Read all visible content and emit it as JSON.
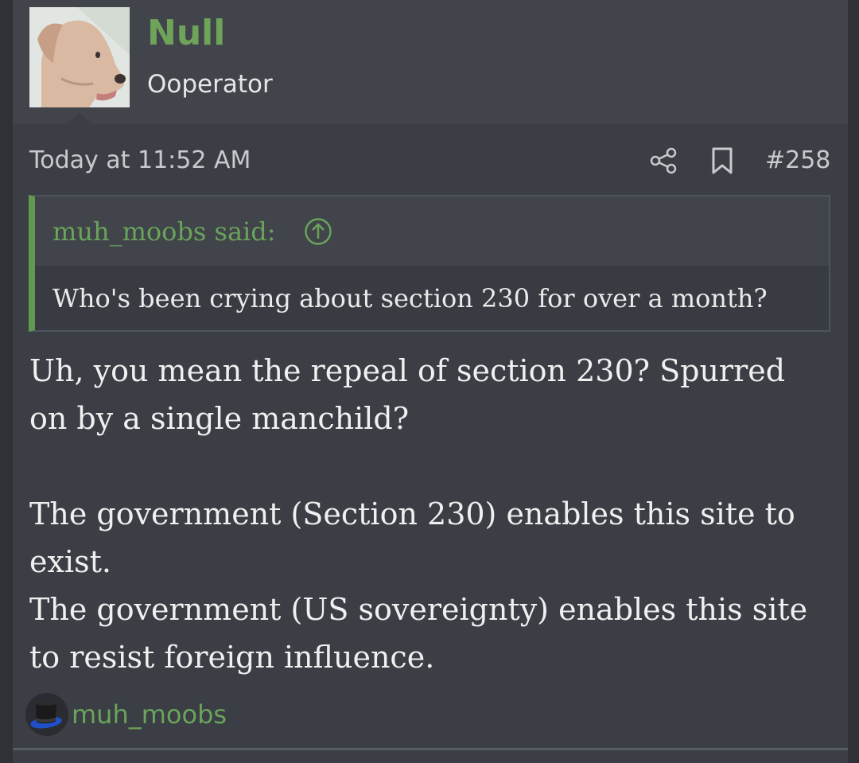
{
  "user": {
    "name": "Null",
    "title": "Ooperator"
  },
  "post": {
    "date": "Today at 11:52 AM",
    "number": "#258"
  },
  "quote": {
    "author": "muh_moobs said:",
    "text": "Who's been crying about section 230 for over a month?"
  },
  "message": {
    "p1": "Uh, you mean the repeal of section 230? Spurred on by a single manchild?",
    "p2": "The government (Section 230) enables this site to exist.",
    "p3": "The government (US sovereignty) enables this site to resist foreign influence."
  },
  "reactions": {
    "icon": "top-hat-icon",
    "user": "muh_moobs"
  },
  "colors": {
    "accent": "#6fa35a",
    "background": "#3b3e45"
  }
}
